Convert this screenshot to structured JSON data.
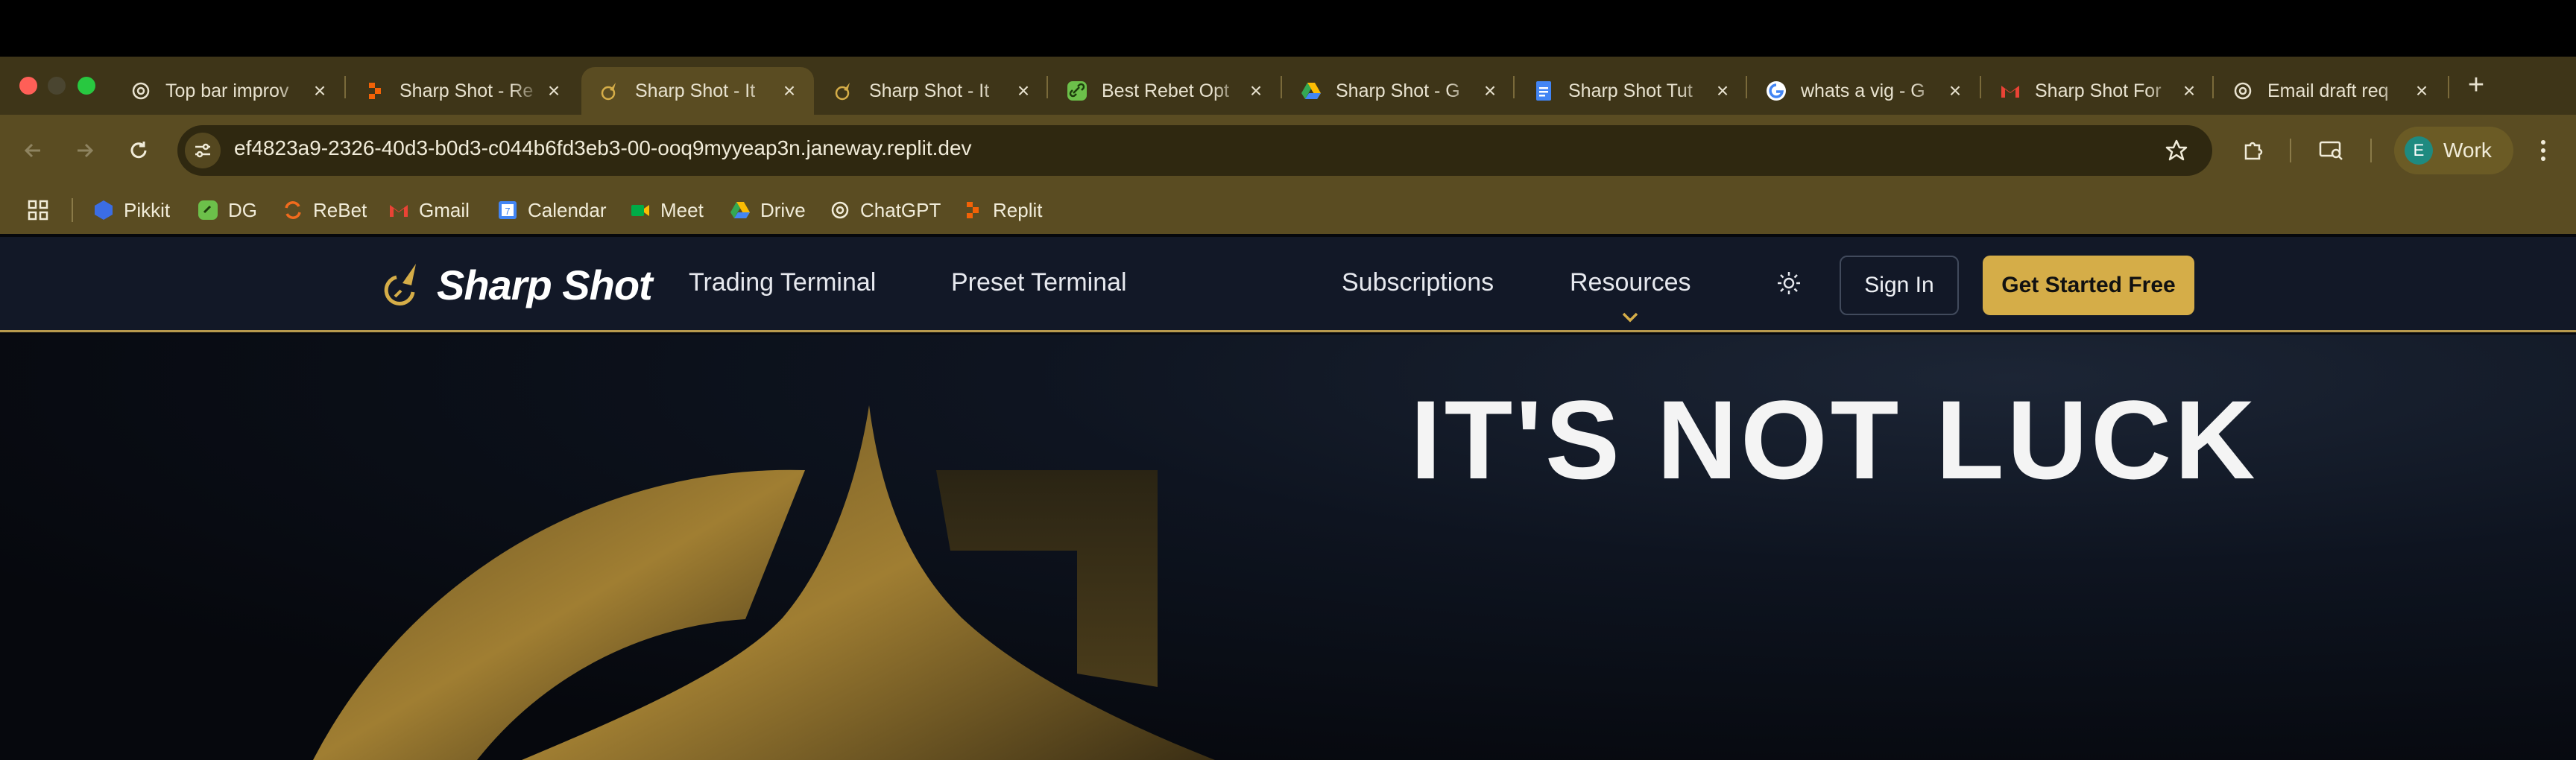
{
  "browser": {
    "tabs": [
      {
        "title": "Top bar improv",
        "icon": "chatgpt-icon",
        "active": false
      },
      {
        "title": "Sharp Shot - Re",
        "icon": "replit-icon",
        "active": false
      },
      {
        "title": "Sharp Shot - It",
        "icon": "sharpshot-icon",
        "active": true
      },
      {
        "title": "Sharp Shot - It",
        "icon": "sharpshot-icon",
        "active": false
      },
      {
        "title": "Best Rebet Opt",
        "icon": "link-icon",
        "active": false
      },
      {
        "title": "Sharp Shot - G",
        "icon": "drive-icon",
        "active": false
      },
      {
        "title": "Sharp Shot Tut",
        "icon": "docs-icon",
        "active": false
      },
      {
        "title": "whats a vig - G",
        "icon": "google-icon",
        "active": false
      },
      {
        "title": "Sharp Shot For",
        "icon": "gmail-icon",
        "active": false
      },
      {
        "title": "Email draft req",
        "icon": "chatgpt-icon",
        "active": false
      }
    ],
    "url": "ef4823a9-2326-40d3-b0d3-c044b6fd3eb3-00-ooq9myyeap3n.janeway.replit.dev",
    "profile": {
      "initial": "E",
      "name": "Work"
    },
    "bookmarks": [
      {
        "label": "Pikkit",
        "icon": "pikkit-icon"
      },
      {
        "label": "DG",
        "icon": "dg-icon"
      },
      {
        "label": "ReBet",
        "icon": "rebet-icon"
      },
      {
        "label": "Gmail",
        "icon": "gmail-icon"
      },
      {
        "label": "Calendar",
        "icon": "calendar-icon"
      },
      {
        "label": "Meet",
        "icon": "meet-icon"
      },
      {
        "label": "Drive",
        "icon": "drive-icon"
      },
      {
        "label": "ChatGPT",
        "icon": "chatgpt-icon"
      },
      {
        "label": "Replit",
        "icon": "replit-icon"
      }
    ]
  },
  "site": {
    "logo_text": "Sharp Shot",
    "nav": {
      "trading_terminal": "Trading Terminal",
      "preset_terminal": "Preset Terminal",
      "subscriptions": "Subscriptions",
      "resources": "Resources"
    },
    "sign_in": "Sign In",
    "get_started": "Get Started Free",
    "hero_title": "IT'S NOT LUCK",
    "colors": {
      "accent": "#d5ad48",
      "nav_bg": "#121827",
      "chrome": "#5a4c22"
    }
  }
}
